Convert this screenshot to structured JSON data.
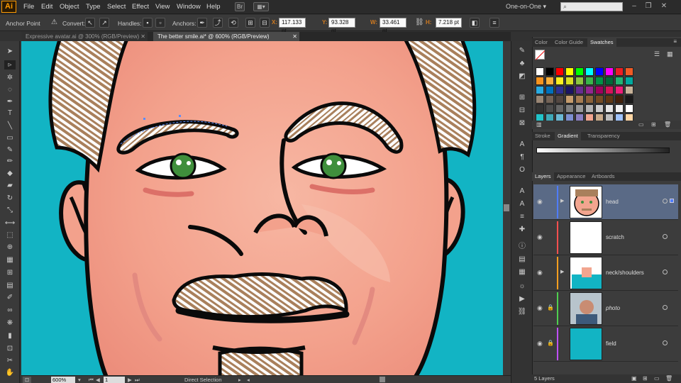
{
  "app": {
    "logo": "Ai"
  },
  "menu": [
    "File",
    "Edit",
    "Object",
    "Type",
    "Select",
    "Effect",
    "View",
    "Window",
    "Help"
  ],
  "menubar_extras": {
    "bridge": "Br",
    "arrange": "▦▾",
    "workspace": "One-on-One ▾"
  },
  "control": {
    "tool_label": "Anchor Point",
    "convert_label": "Convert:",
    "handles_label": "Handles:",
    "anchors_label": "Anchors:",
    "x_label": "X:",
    "x_value": "117.133 pt",
    "y_label": "Y:",
    "y_value": "93.328 pt",
    "w_label": "W:",
    "w_value": "33.461 pt",
    "h_label": "H:",
    "h_value": "7.218 pt"
  },
  "tabs": [
    {
      "label": "Expressive avatar.ai @ 300% (RGB/Preview)",
      "active": false
    },
    {
      "label": "The better smile.ai* @ 600% (RGB/Preview)",
      "active": true
    }
  ],
  "status": {
    "zoom": "600%",
    "artboard": "1",
    "tool": "Direct Selection"
  },
  "swatch_tabs": [
    "Color",
    "Color Guide",
    "Swatches"
  ],
  "gradient_tabs": [
    "Stroke",
    "Gradient",
    "Transparency"
  ],
  "layers_tabs": [
    "Layers",
    "Appearance",
    "Artboards"
  ],
  "layers": [
    {
      "name": "head",
      "color": "#4f7cff",
      "locked": false,
      "selected": true,
      "italic": false
    },
    {
      "name": "scratch",
      "color": "#ff4f4f",
      "locked": false,
      "selected": false,
      "italic": false
    },
    {
      "name": "neck/shoulders",
      "color": "#ff9f1f",
      "locked": false,
      "selected": false,
      "italic": false
    },
    {
      "name": "photo",
      "color": "#4fcf4f",
      "locked": true,
      "selected": false,
      "italic": true
    },
    {
      "name": "field",
      "color": "#c04fff",
      "locked": true,
      "selected": false,
      "italic": false
    }
  ],
  "layers_footer": "5 Layers",
  "colors": {
    "canvas_bg": "#12b4c4",
    "skin": "#f2a58f",
    "accent": "#ff9a00"
  },
  "swatches": [
    [
      "#ffffff",
      "#000000",
      "#ff0000",
      "#ffff00",
      "#00ff00",
      "#00ffff",
      "#0000ff",
      "#ff00ff",
      "#ed1c24",
      "#f15a24"
    ],
    [
      "#f7931e",
      "#fbb03b",
      "#fcee21",
      "#d9e021",
      "#8cc63f",
      "#39b54a",
      "#009245",
      "#006837",
      "#22b573",
      "#00a99d"
    ],
    [
      "#29abe2",
      "#0071bc",
      "#2e3192",
      "#1b1464",
      "#662d91",
      "#93278f",
      "#9e005d",
      "#d4145a",
      "#ed1e79",
      "#c7b299"
    ],
    [
      "#998675",
      "#736357",
      "#534741",
      "#c69c6d",
      "#a67c52",
      "#8c6239",
      "#754c24",
      "#603813",
      "#42210b",
      "#1a1a1a"
    ],
    [
      "#333333",
      "#4d4d4d",
      "#666666",
      "#808080",
      "#999999",
      "#b3b3b3",
      "#cccccc",
      "#e6e6e6",
      "#f2f2f2",
      "#ffffff"
    ],
    [
      "#22c3c9",
      "#3fa8b8",
      "#6bb8d4",
      "#7d8fd1",
      "#8b7fc2",
      "#f2a58f",
      "#c9aa8a",
      "#bfbfbf",
      "#a0c4ff",
      "#ffd6a5"
    ]
  ]
}
